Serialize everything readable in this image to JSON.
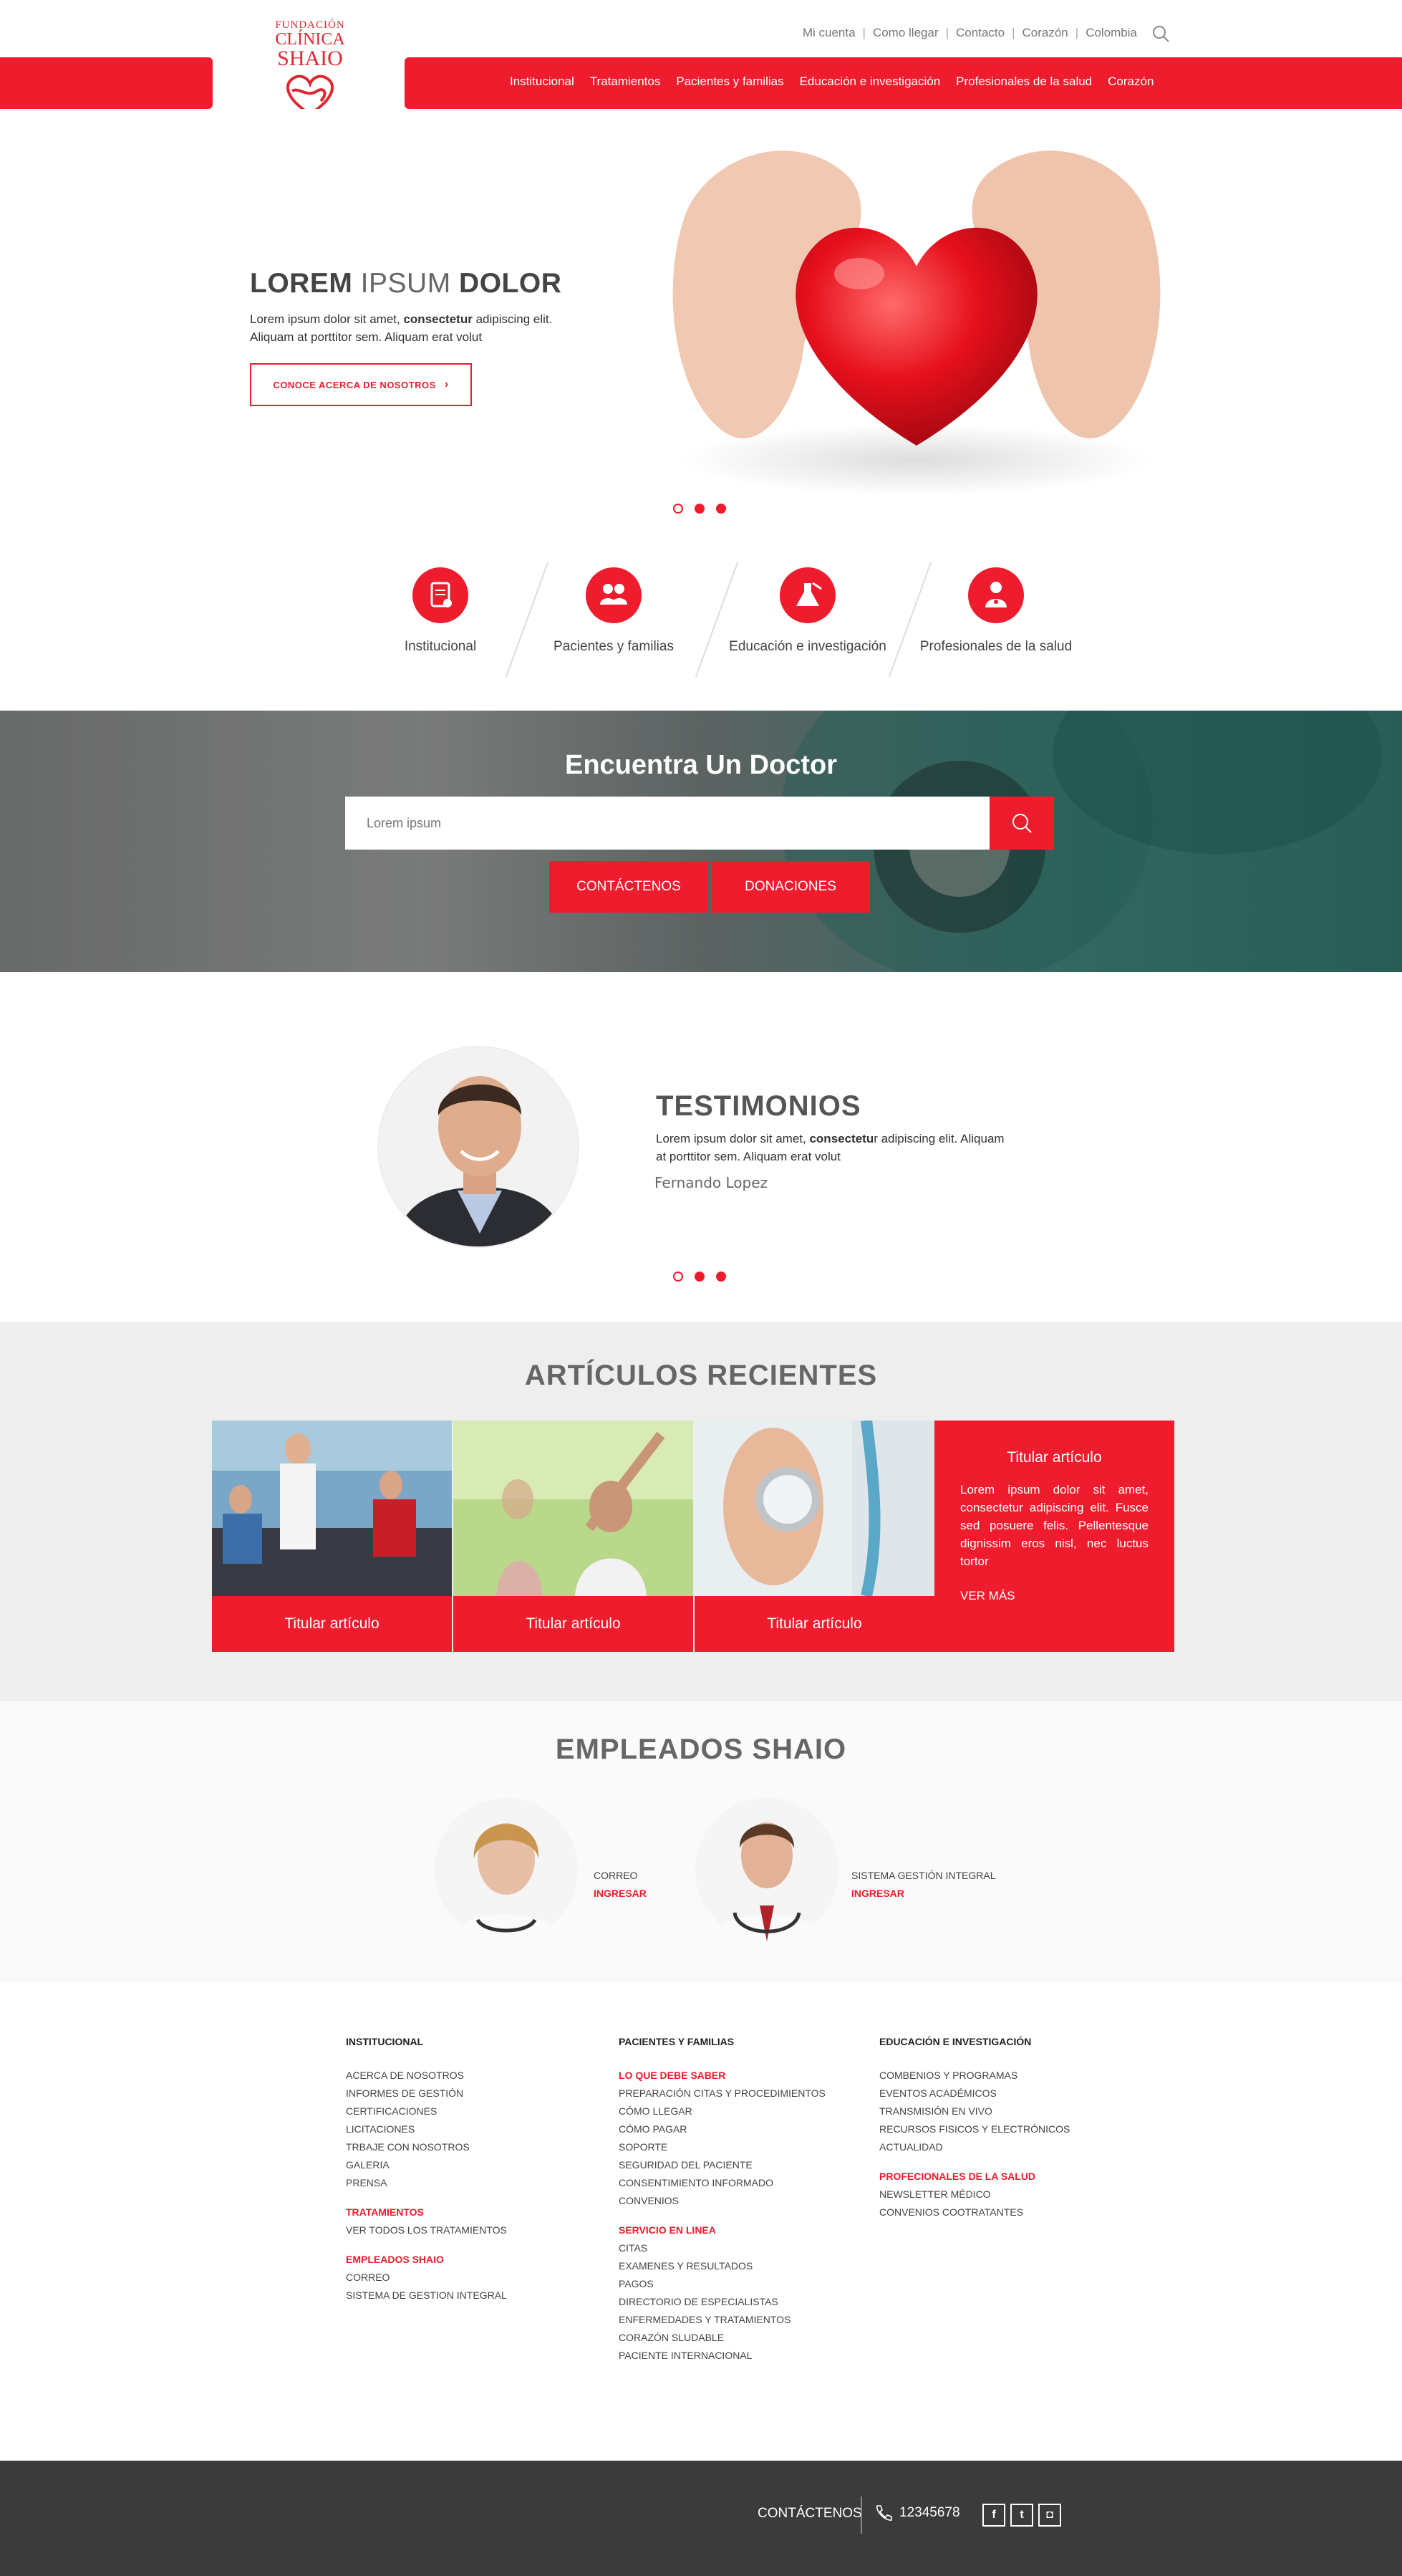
{
  "brand": {
    "line1": "FUNDACIÓN",
    "line2": "CLÍNICA",
    "line3": "SHAIO",
    "accent": "#ee1c2d"
  },
  "topnav": [
    "Mi cuenta",
    "Como llegar",
    "Contacto",
    "Corazón",
    "Colombia"
  ],
  "mainnav": [
    "Institucional",
    "Tratamientos",
    "Pacientes y familias",
    "Educación e investigación",
    "Profesionales de la salud",
    "Corazón"
  ],
  "hero": {
    "title_b1": "LOREM",
    "title_l": "IPSUM",
    "title_b2": "DOLOR",
    "text_a": "Lorem ipsum dolor sit amet, ",
    "text_b": "consectetur",
    "text_c": " adipiscing elit. Aliquam at porttitor sem. Aliquam erat volut",
    "button": "CONOCE ACERCA DE NOSOTROS",
    "button_icon": "chevron-right-icon"
  },
  "quicklinks": [
    {
      "label": "Institucional",
      "icon": "clipboard-icon"
    },
    {
      "label": "Pacientes y familias",
      "icon": "people-icon"
    },
    {
      "label": "Educación e investigación",
      "icon": "flask-icon"
    },
    {
      "label": "Profesionales de la salud",
      "icon": "doctor-icon"
    }
  ],
  "finder": {
    "title": "Encuentra Un Doctor",
    "placeholder": "Lorem ipsum",
    "btn_contact": "CONTÁCTENOS",
    "btn_donate": "DONACIONES"
  },
  "testimonials": {
    "title": "TESTIMONIOS",
    "text_a": "Lorem ipsum dolor sit amet, ",
    "text_b": "consectetu",
    "text_c": "r adipiscing elit. Aliquam at porttitor sem. Aliquam erat volut",
    "name": "Fernando Lopez"
  },
  "articles": {
    "title": "ARTÍCULOS RECIENTES",
    "items": [
      {
        "caption": "Titular artículo"
      },
      {
        "caption": "Titular artículo"
      },
      {
        "caption": "Titular artículo"
      }
    ],
    "featured": {
      "title": "Titular artículo",
      "text": "Lorem ipsum dolor sit amet, consectetur adipiscing elit. Fusce sed posuere felis. Pellentesque dignissim eros nisl, nec luctus tortor",
      "more": "VER MÁS"
    }
  },
  "employees": {
    "title": "EMPLEADOS SHAIO",
    "items": [
      {
        "label": "CORREO",
        "link": "INGRESAR"
      },
      {
        "label": "SISTEMA GESTIÓN INTEGRAL",
        "link": "INGRESAR"
      }
    ]
  },
  "footer": {
    "col1": {
      "heading": "INSTITUCIONAL",
      "links": [
        "ACERCA DE NOSOTROS",
        "INFORMES DE GESTIÓN",
        "CERTIFICACIONES",
        "LICITACIONES",
        "TRBAJE CON NOSOTROS",
        "GALERIA",
        "PRENSA"
      ],
      "sub1": "TRATAMIENTOS",
      "sub1_links": [
        "VER TODOS LOS TRATAMIENTOS"
      ],
      "sub2": "EMPLEADOS SHAIO",
      "sub2_links": [
        "CORREO",
        "SISTEMA DE GESTION INTEGRAL"
      ]
    },
    "col2": {
      "heading": "PACIENTES Y FAMILIAS",
      "sub1": "LO QUE DEBE SABER",
      "sub1_links": [
        "PREPARACIÓN CITAS Y PROCEDIMIENTOS",
        "CÓMO LLEGAR",
        "CÓMO PAGAR",
        "SOPORTE",
        "SEGURIDAD DEL PACIENTE",
        "CONSENTIMIENTO INFORMADO",
        "CONVENIOS"
      ],
      "sub2": "SERVICIO EN LINEA",
      "sub2_links": [
        "CITAS",
        "EXAMENES Y RESULTADOS",
        "PAGOS",
        "DIRECTORIO DE ESPECIALISTAS",
        "ENFERMEDADES Y TRATAMIENTOS",
        "CORAZÓN SLUDABLE",
        "PACIENTE INTERNACIONAL"
      ]
    },
    "col3": {
      "heading": "EDUCACIÓN E INVESTIGACIÓN",
      "links": [
        "COMBENIOS Y PROGRAMAS",
        "EVENTOS ACADÉMICOS",
        "TRANSMISIÓN EN VIVO",
        "RECURSOS FISICOS Y ELECTRÓNICOS",
        "ACTUALIDAD"
      ],
      "sub1": "PROFECIONALES DE LA SALUD",
      "sub1_links": [
        "NEWSLETTER MÉDICO",
        "CONVENIOS COOTRATANTES"
      ]
    }
  },
  "bottombar": {
    "contact": "CONTÁCTENOS",
    "phone": "12345678",
    "social": [
      {
        "icon": "facebook-icon",
        "glyph": "f"
      },
      {
        "icon": "twitter-icon",
        "glyph": "t"
      },
      {
        "icon": "instagram-icon",
        "glyph": "◘"
      }
    ]
  }
}
